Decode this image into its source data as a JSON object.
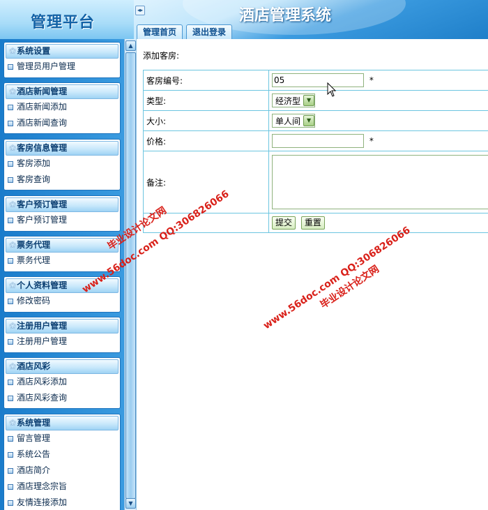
{
  "header": {
    "logo": "管理平台",
    "system_title": "酒店管理系统",
    "toggle_icon": "◂▸",
    "tabs": [
      {
        "label": "管理首页"
      },
      {
        "label": "退出登录"
      }
    ]
  },
  "sidebar": {
    "groups": [
      {
        "title": "系统设置",
        "items": [
          "管理员用户管理"
        ]
      },
      {
        "title": "酒店新闻管理",
        "items": [
          "酒店新闻添加",
          "酒店新闻查询"
        ]
      },
      {
        "title": "客房信息管理",
        "items": [
          "客房添加",
          "客房查询"
        ]
      },
      {
        "title": "客户预订管理",
        "items": [
          "客户预订管理"
        ]
      },
      {
        "title": "票务代理",
        "items": [
          "票务代理"
        ]
      },
      {
        "title": "个人资料管理",
        "items": [
          "修改密码"
        ]
      },
      {
        "title": "注册用户管理",
        "items": [
          "注册用户管理"
        ]
      },
      {
        "title": "酒店风彩",
        "items": [
          "酒店风彩添加",
          "酒店风彩查询"
        ]
      },
      {
        "title": "系统管理",
        "items": [
          "留言管理",
          "系统公告",
          "酒店简介",
          "酒店理念宗旨",
          "友情连接添加"
        ]
      }
    ]
  },
  "main": {
    "page_title": "添加客房:",
    "form": {
      "room_number": {
        "label": "客房编号:",
        "value": "05",
        "required": "*"
      },
      "type": {
        "label": "类型:",
        "value": "经济型"
      },
      "size": {
        "label": "大小:",
        "value": "单人间"
      },
      "price": {
        "label": "价格:",
        "value": "",
        "required": "*"
      },
      "remark": {
        "label": "备注:",
        "value": ""
      },
      "submit": "提交",
      "reset": "重置"
    }
  },
  "watermarks": {
    "w1": "毕业设计论文网",
    "w2": "www.56doc.com   QQ:306826066",
    "w3": "www.56doc.com   QQ:306826066",
    "w4": "毕业设计论文网"
  },
  "colors": {
    "header_blue": "#2a8fd6",
    "sidebar_blue": "#1a7ccb",
    "table_border": "#6cc5e0",
    "watermark_red": "#d9211a"
  }
}
